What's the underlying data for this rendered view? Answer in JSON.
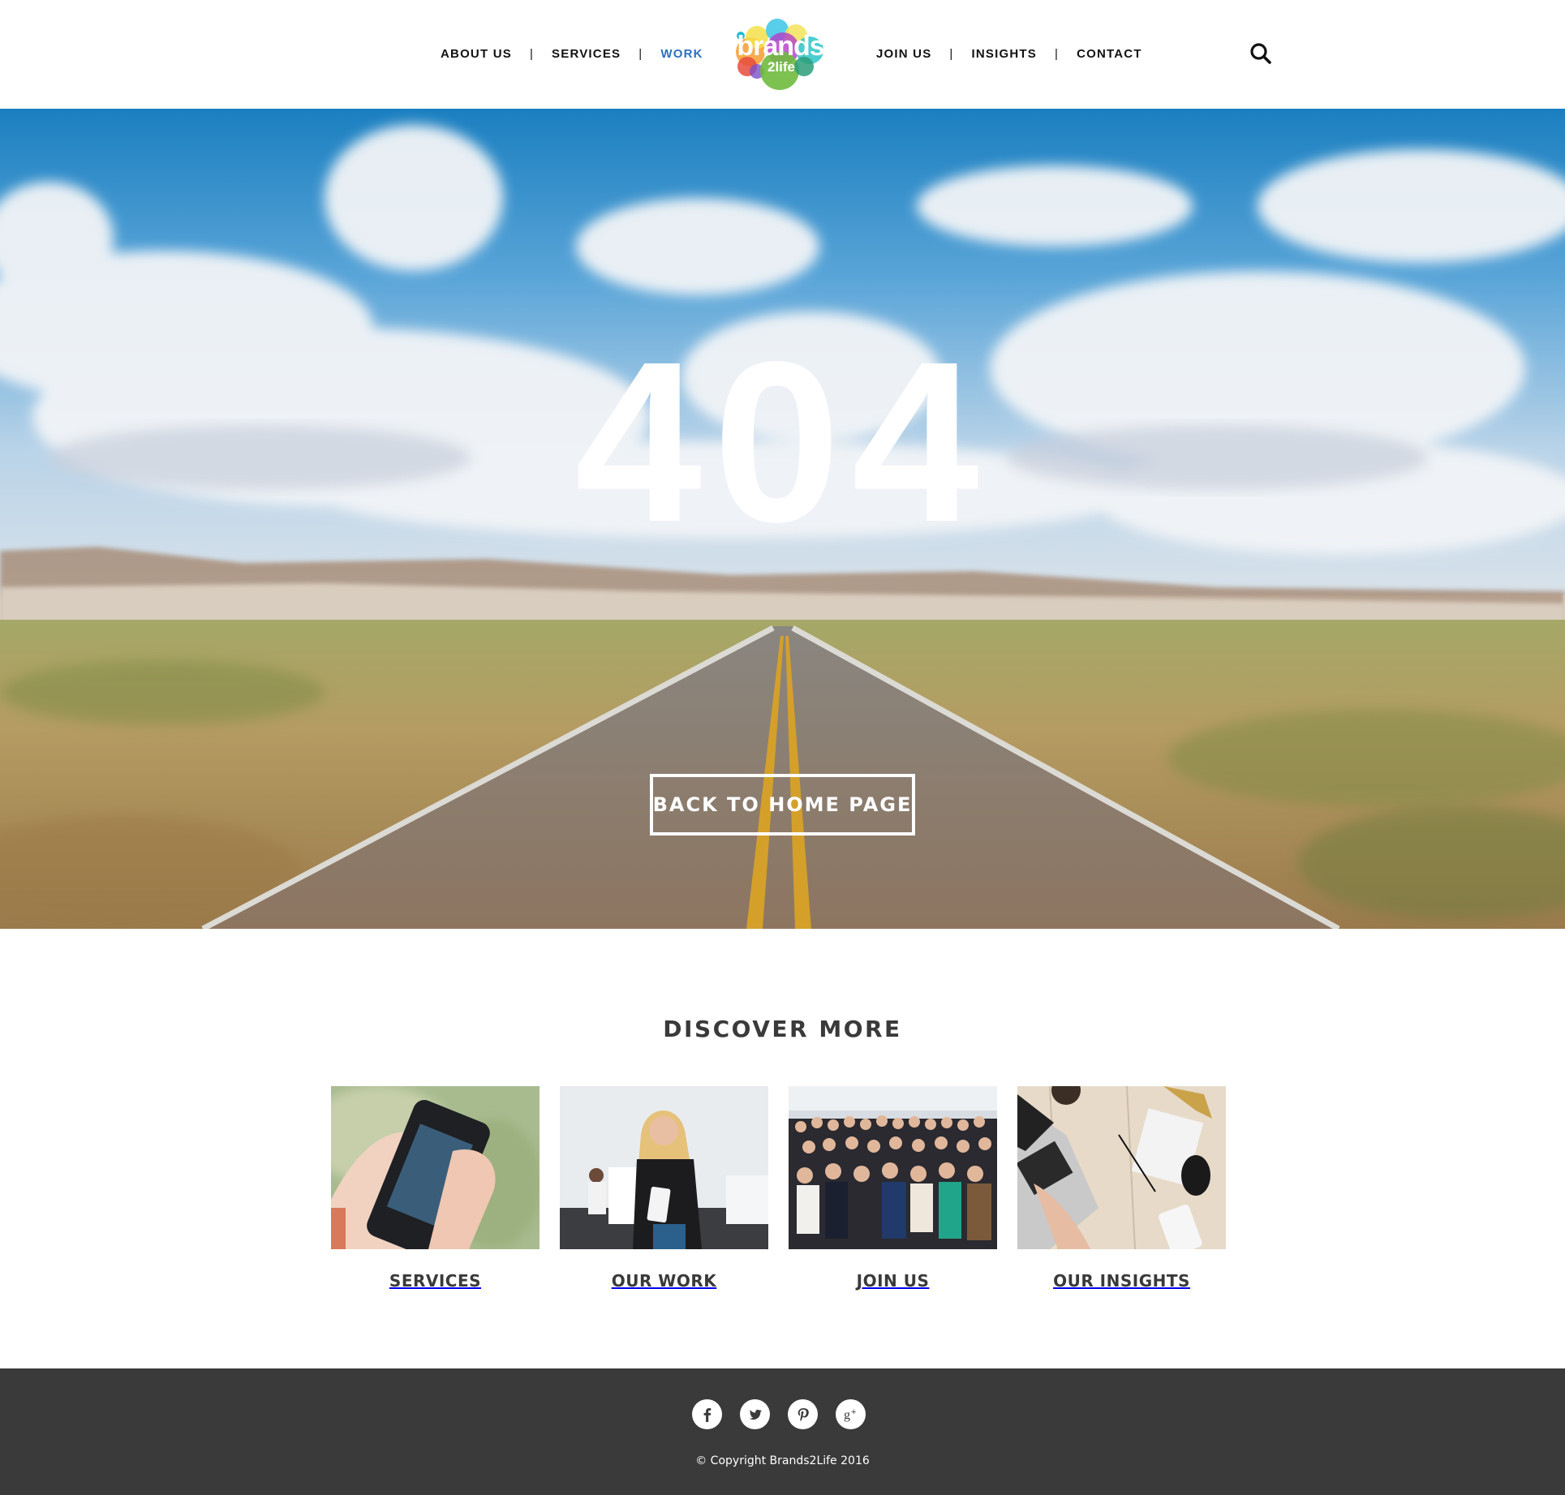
{
  "header": {
    "nav_left": [
      {
        "label": "ABOUT US",
        "active": false
      },
      {
        "label": "SERVICES",
        "active": false
      },
      {
        "label": "WORK",
        "active": true
      }
    ],
    "nav_right": [
      {
        "label": "JOIN US",
        "active": false
      },
      {
        "label": "INSIGHTS",
        "active": false
      },
      {
        "label": "CONTACT",
        "active": false
      }
    ],
    "separator": "|",
    "logo": {
      "word_top": "brands",
      "word_bottom": "2life"
    },
    "search_icon": "search-icon",
    "active_color": "#2a72c0"
  },
  "hero": {
    "error_code": "404",
    "button_label": "BACK TO HOME PAGE",
    "background": "desert-road-with-cloudy-sky"
  },
  "discover": {
    "title": "DISCOVER MORE",
    "cards": [
      {
        "label": "SERVICES",
        "image": "hand-holding-smartphone"
      },
      {
        "label": "OUR WORK",
        "image": "woman-holding-phone-at-event"
      },
      {
        "label": "JOIN US",
        "image": "team-group-photo"
      },
      {
        "label": "OUR INSIGHTS",
        "image": "laptop-on-wooden-desk"
      }
    ]
  },
  "footer": {
    "social": [
      {
        "name": "facebook-icon",
        "glyph": "f"
      },
      {
        "name": "twitter-icon",
        "glyph": "bird"
      },
      {
        "name": "pinterest-icon",
        "glyph": "p"
      },
      {
        "name": "google-plus-icon",
        "glyph": "g+"
      }
    ],
    "copyright": "© Copyright Brands2Life 2016",
    "background_color": "#3a3a3a"
  }
}
